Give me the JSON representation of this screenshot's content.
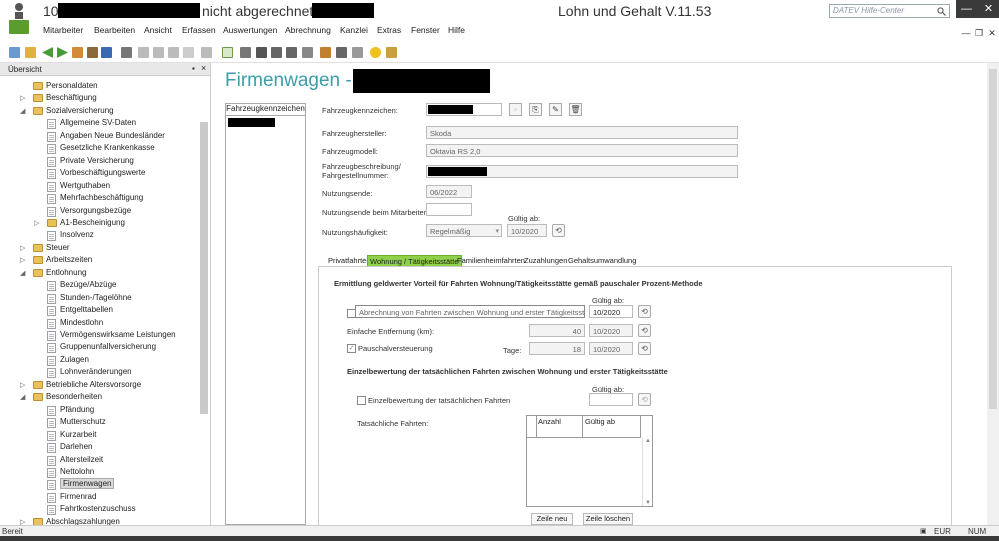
{
  "window": {
    "title_prefix": "10",
    "title_mid": "nicht abgerechnet / 1",
    "app_title": "Lohn und Gehalt V.11.53",
    "help_placeholder": "DATEV Hilfe-Center",
    "controls": [
      "—",
      "☐",
      "✕"
    ]
  },
  "menu": [
    "Mitarbeiter",
    "Bearbeiten",
    "Ansicht",
    "Erfassen",
    "Auswertungen",
    "Abrechnung",
    "Kanzlei",
    "Extras",
    "Fenster",
    "Hilfe"
  ],
  "mdi_controls": [
    "—",
    "❐",
    "✕"
  ],
  "sidebar": {
    "header": "Übersicht",
    "items": [
      {
        "label": "Personaldaten",
        "type": "folder",
        "level": 0,
        "expander": ""
      },
      {
        "label": "Beschäftigung",
        "type": "folder",
        "level": 0,
        "expander": "▷"
      },
      {
        "label": "Sozialversicherung",
        "type": "folder",
        "level": 0,
        "expander": "◢"
      },
      {
        "label": "Allgemeine SV-Daten",
        "type": "leaf",
        "level": 1,
        "expander": ""
      },
      {
        "label": "Angaben Neue Bundesländer",
        "type": "leaf",
        "level": 1,
        "expander": ""
      },
      {
        "label": "Gesetzliche Krankenkasse",
        "type": "leaf",
        "level": 1,
        "expander": ""
      },
      {
        "label": "Private Versicherung",
        "type": "leaf",
        "level": 1,
        "expander": ""
      },
      {
        "label": "Vorbeschäftigungswerte",
        "type": "leaf",
        "level": 1,
        "expander": ""
      },
      {
        "label": "Wertguthaben",
        "type": "leaf",
        "level": 1,
        "expander": ""
      },
      {
        "label": "Mehrfachbeschäftigung",
        "type": "leaf",
        "level": 1,
        "expander": ""
      },
      {
        "label": "Versorgungsbezüge",
        "type": "leaf",
        "level": 1,
        "expander": ""
      },
      {
        "label": "A1-Bescheinigung",
        "type": "folder",
        "level": 1,
        "expander": "▷"
      },
      {
        "label": "Insolvenz",
        "type": "leaf",
        "level": 1,
        "expander": ""
      },
      {
        "label": "Steuer",
        "type": "folder",
        "level": 0,
        "expander": "▷"
      },
      {
        "label": "Arbeitszeiten",
        "type": "folder",
        "level": 0,
        "expander": "▷"
      },
      {
        "label": "Entlohnung",
        "type": "folder",
        "level": 0,
        "expander": "◢"
      },
      {
        "label": "Bezüge/Abzüge",
        "type": "leaf",
        "level": 1,
        "expander": ""
      },
      {
        "label": "Stunden-/Tagelöhne",
        "type": "leaf",
        "level": 1,
        "expander": ""
      },
      {
        "label": "Entgelttabellen",
        "type": "leaf",
        "level": 1,
        "expander": ""
      },
      {
        "label": "Mindestlohn",
        "type": "leaf",
        "level": 1,
        "expander": ""
      },
      {
        "label": "Vermögenswirksame Leistungen",
        "type": "leaf",
        "level": 1,
        "expander": ""
      },
      {
        "label": "Gruppenunfallversicherung",
        "type": "leaf",
        "level": 1,
        "expander": ""
      },
      {
        "label": "Zulagen",
        "type": "leaf",
        "level": 1,
        "expander": ""
      },
      {
        "label": "Lohnveränderungen",
        "type": "leaf",
        "level": 1,
        "expander": ""
      },
      {
        "label": "Betriebliche Altersvorsorge",
        "type": "folder",
        "level": 0,
        "expander": "▷"
      },
      {
        "label": "Besonderheiten",
        "type": "folder",
        "level": 0,
        "expander": "◢"
      },
      {
        "label": "Pfändung",
        "type": "leaf",
        "level": 1,
        "expander": ""
      },
      {
        "label": "Mutterschutz",
        "type": "leaf",
        "level": 1,
        "expander": ""
      },
      {
        "label": "Kurzarbeit",
        "type": "leaf",
        "level": 1,
        "expander": ""
      },
      {
        "label": "Darlehen",
        "type": "leaf",
        "level": 1,
        "expander": ""
      },
      {
        "label": "Altersteilzeit",
        "type": "leaf",
        "level": 1,
        "expander": ""
      },
      {
        "label": "Nettolohn",
        "type": "leaf",
        "level": 1,
        "expander": ""
      },
      {
        "label": "Firmenwagen",
        "type": "leaf",
        "level": 1,
        "expander": "",
        "selected": true
      },
      {
        "label": "Firmenrad",
        "type": "leaf",
        "level": 1,
        "expander": ""
      },
      {
        "label": "Fahrtkostenzuschuss",
        "type": "leaf",
        "level": 1,
        "expander": ""
      },
      {
        "label": "Abschlagszahlungen",
        "type": "folder",
        "level": 0,
        "expander": "▷"
      }
    ]
  },
  "main": {
    "heading": "Firmenwagen - 10",
    "list_header": "Fahrzeugkennzeichen",
    "fields": {
      "kennzeichen_label": "Fahrzeugkennzeichen:",
      "hersteller_label": "Fahrzeughersteller:",
      "hersteller_value": "Skoda",
      "modell_label": "Fahrzeugmodell:",
      "modell_value": "Oktavia RS 2,0",
      "beschreibung_label1": "Fahrzeugbeschreibung/",
      "beschreibung_label2": "Fahrgestellnummer:",
      "nutzungsende_label": "Nutzungsende:",
      "nutzungsende_value": "06/2022",
      "nutzungsende_ma_label": "Nutzungsende beim Mitarbeiter:",
      "nutzungsende_ma_value": "",
      "gueltig_ab_label": "Gültig ab:",
      "haeufigkeit_label": "Nutzungshäufigkeit:",
      "haeufigkeit_value": "Regelmäßig",
      "haeufigkeit_gueltig": "10/2020"
    },
    "tabs": [
      {
        "label": "Privatfahrten",
        "active": false
      },
      {
        "label": "Wohnung / Tätigkeitsstätte",
        "active": true
      },
      {
        "label": "Familienheimfahrten",
        "active": false
      },
      {
        "label": "Zuzahlungen",
        "active": false
      },
      {
        "label": "Gehaltsumwandlung",
        "active": false
      }
    ],
    "section1": {
      "title": "Ermittlung geldwerter Vorteil für Fahrten Wohnung/Tätigkeitsstätte gemäß pauschaler Prozent-Methode",
      "gueltig_ab": "Gültig ab:",
      "abrechnung_label": "Abrechnung von Fahrten zwischen Wohnung und erster Tätigkeitsstätte",
      "abrechnung_date": "10/2020",
      "entfernung_label": "Einfache Entfernung (km):",
      "entfernung_value": "40",
      "entfernung_date": "10/2020",
      "pauschal_label": "Pauschalversteuerung",
      "pauschal_checked": "✓",
      "tage_label": "Tage:",
      "tage_value": "18",
      "tage_date": "10/2020"
    },
    "section2": {
      "title": "Einzelbewertung der tatsächlichen Fahrten zwischen Wohnung und erster Tätigkeitsstätte",
      "gueltig_ab": "Gültig ab:",
      "einzel_label": "Einzelbewertung der tatsächlichen Fahrten",
      "einzel_date": "",
      "fahrten_label": "Tatsächliche Fahrten:",
      "grid_columns": [
        "Anzahl",
        "Gültig ab"
      ],
      "btn_new": "Zeile neu",
      "btn_delete": "Zeile löschen"
    }
  },
  "status": {
    "left": "Bereit",
    "currency": "EUR",
    "num": "NUM"
  },
  "colors": {
    "heading": "#3b9ea8",
    "active_tab": "#8ed04a",
    "window_controls": "#3a3a3a",
    "close": "#3a3a3a"
  }
}
